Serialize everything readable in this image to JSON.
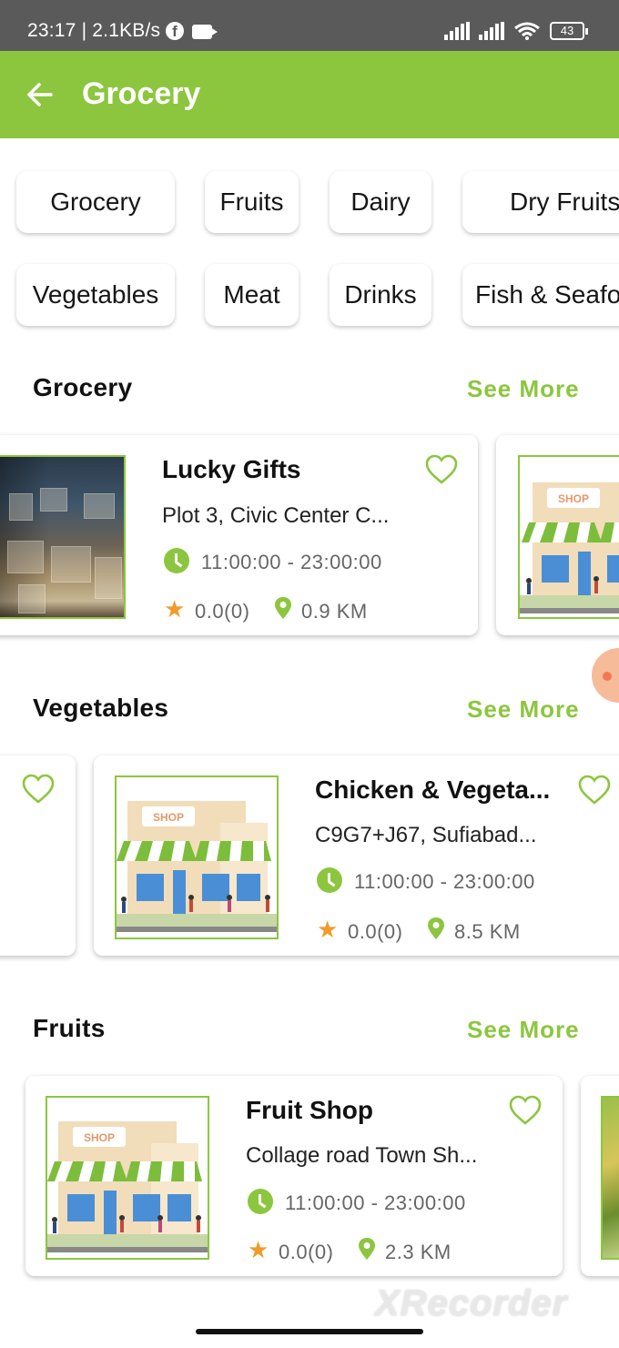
{
  "status_bar": {
    "time_speed": "23:17 | 2.1KB/s",
    "battery": "43"
  },
  "app_bar": {
    "title": "Grocery"
  },
  "categories": [
    "Grocery",
    "Fruits",
    "Dairy",
    "Dry Fruits",
    "Vegetables",
    "Meat",
    "Drinks",
    "Fish & Seafo"
  ],
  "sections": [
    {
      "title": "Grocery",
      "see_more": "See More",
      "stores": [
        {
          "name": "Lucky Gifts",
          "address": "Plot 3, Civic Center C...",
          "hours": "11:00:00 - 23:00:00",
          "rating": "0.0(0)",
          "distance": "0.9 KM"
        }
      ]
    },
    {
      "title": "Vegetables",
      "see_more": "See More",
      "stores": [
        {
          "name": "Chicken & Vegeta...",
          "address": "C9G7+J67, Sufiabad...",
          "hours": "11:00:00 - 23:00:00",
          "rating": "0.0(0)",
          "distance": "8.5 KM"
        }
      ]
    },
    {
      "title": "Fruits",
      "see_more": "See More",
      "stores": [
        {
          "name": "Fruit Shop",
          "address": "Collage road Town Sh...",
          "hours": "11:00:00 - 23:00:00",
          "rating": "0.0(0)",
          "distance": "2.3 KM"
        }
      ]
    }
  ],
  "shop_sign": "SHOP",
  "watermark": "XRecorder",
  "colors": {
    "accent": "#8cc63f",
    "star": "#f39a2b",
    "status_bar": "#5a5a5a"
  }
}
